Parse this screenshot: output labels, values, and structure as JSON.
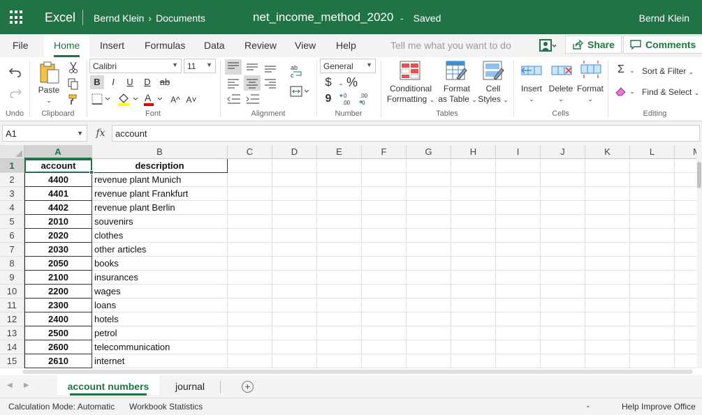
{
  "titlebar": {
    "app_name": "Excel",
    "breadcrumb_user": "Bernd Klein",
    "breadcrumb_sep": "›",
    "breadcrumb_folder": "Documents",
    "doc_title": "net_income_method_2020",
    "dash": "-",
    "save_status": "Saved",
    "user_name": "Bernd Klein"
  },
  "ribbon_tabs": [
    "File",
    "Home",
    "Insert",
    "Formulas",
    "Data",
    "Review",
    "View",
    "Help"
  ],
  "active_tab": "Home",
  "tell_me": "Tell me what you want to do",
  "share_label": "Share",
  "comments_label": "Comments",
  "groups": {
    "undo": "Undo",
    "clipboard": "Clipboard",
    "font": "Font",
    "alignment": "Alignment",
    "number": "Number",
    "tables": "Tables",
    "cells": "Cells",
    "editing": "Editing"
  },
  "clipboard": {
    "paste": "Paste"
  },
  "font": {
    "name": "Calibri",
    "size": "11",
    "bold": "B",
    "italic": "I",
    "underline": "U",
    "double_underline": "D",
    "strike": "ab",
    "grow": "A^",
    "shrink": "A˅"
  },
  "number": {
    "format": "General",
    "currency": "$",
    "percent": "%",
    "comma": "9"
  },
  "tables": {
    "conditional_1": "Conditional",
    "conditional_2": "Formatting",
    "format_table_1": "Format",
    "format_table_2": "as Table",
    "cell_styles_1": "Cell",
    "cell_styles_2": "Styles"
  },
  "cells": {
    "insert": "Insert",
    "delete": "Delete",
    "format": "Format"
  },
  "editing": {
    "sum": "Σ",
    "sort_filter": "Sort & Filter",
    "find_select": "Find & Select"
  },
  "formula_bar": {
    "name_box": "A1",
    "fx": "fx",
    "value": "account"
  },
  "columns": [
    "A",
    "B",
    "C",
    "D",
    "E",
    "F",
    "G",
    "H",
    "I",
    "J",
    "K",
    "L",
    "M"
  ],
  "rows": [
    "1",
    "2",
    "3",
    "4",
    "5",
    "6",
    "7",
    "8",
    "9",
    "10",
    "11",
    "12",
    "13",
    "14",
    "15"
  ],
  "header_row": {
    "account": "account",
    "description": "description"
  },
  "data_rows": [
    {
      "account": "4400",
      "description": "revenue plant Munich"
    },
    {
      "account": "4401",
      "description": "revenue plant Frankfurt"
    },
    {
      "account": "4402",
      "description": "revenue plant Berlin"
    },
    {
      "account": "2010",
      "description": "souvenirs"
    },
    {
      "account": "2020",
      "description": "clothes"
    },
    {
      "account": "2030",
      "description": "other articles"
    },
    {
      "account": "2050",
      "description": "books"
    },
    {
      "account": "2100",
      "description": "insurances"
    },
    {
      "account": "2200",
      "description": "wages"
    },
    {
      "account": "2300",
      "description": "loans"
    },
    {
      "account": "2400",
      "description": "hotels"
    },
    {
      "account": "2500",
      "description": "petrol"
    },
    {
      "account": "2600",
      "description": "telecommunication"
    },
    {
      "account": "2610",
      "description": "internet"
    }
  ],
  "sheets": [
    "account numbers",
    "journal"
  ],
  "active_sheet": "account numbers",
  "status_bar": {
    "calc_mode": "Calculation Mode: Automatic",
    "workbook_stats": "Workbook Statistics",
    "help_improve": "Help Improve Office"
  },
  "colors": {
    "brand": "#217346",
    "ribbon_bg": "#f3f3f3"
  }
}
